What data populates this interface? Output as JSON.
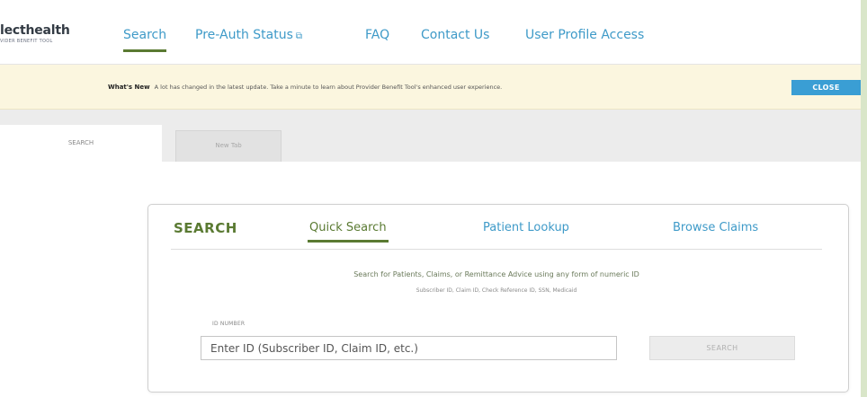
{
  "nav": {
    "logo_name": "lecthealth",
    "logo_sub": "VIDER BENEFIT TOOL",
    "items": [
      {
        "label": "Search"
      },
      {
        "label": "Pre-Auth Status"
      },
      {
        "label": "FAQ"
      },
      {
        "label": "Contact Us"
      },
      {
        "label": "User Profile Access"
      }
    ],
    "external_icon": "external-link-icon"
  },
  "banner": {
    "title": "What's New",
    "message": "A lot has changed in the latest update. Take a minute to learn about Provider Benefit Tool's enhanced user experience.",
    "close_label": "CLOSE"
  },
  "tabs": [
    {
      "label": "SEARCH"
    },
    {
      "label": "New Tab"
    }
  ],
  "card": {
    "title": "SEARCH",
    "tabs": [
      {
        "label": "Quick Search"
      },
      {
        "label": "Patient Lookup"
      },
      {
        "label": "Browse Claims"
      }
    ],
    "description": "Search for Patients, Claims, or Remittance Advice using any form of numeric ID",
    "sub_description": "Subscriber ID, Claim ID, Check Reference ID, SSN, Medicaid",
    "id_label": "ID NUMBER",
    "id_placeholder": "Enter ID (Subscriber ID, Claim ID, etc.)",
    "search_button": "SEARCH"
  },
  "colors": {
    "brand_green": "#5a7a32",
    "link_blue": "#3e9ac8",
    "close_blue": "#3a9ed4",
    "banner_bg": "#fbf6df"
  }
}
